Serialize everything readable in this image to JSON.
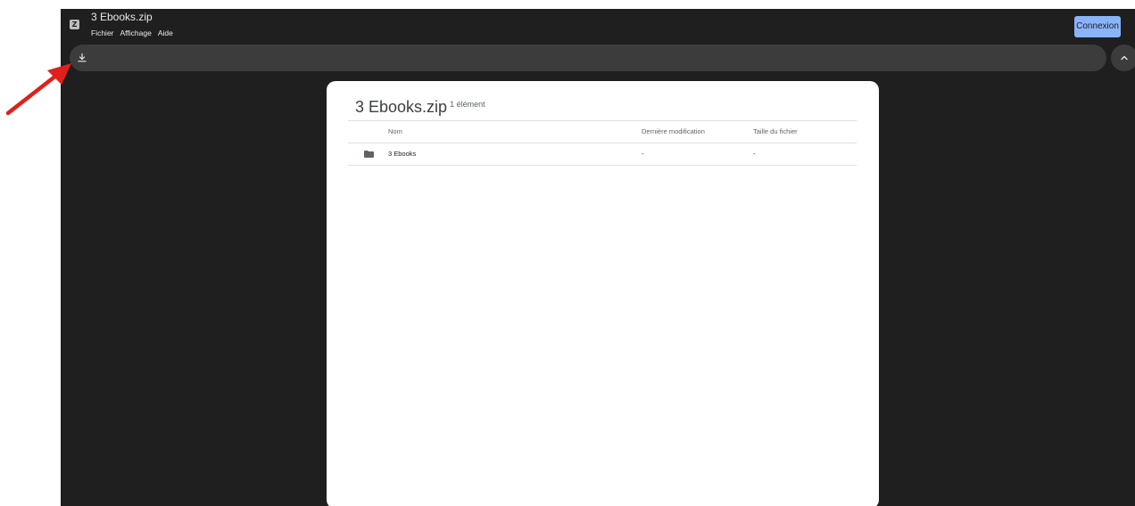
{
  "header": {
    "app_icon_glyph": "Z",
    "title": "3 Ebooks.zip",
    "menu": [
      "Fichier",
      "Affichage",
      "Aide"
    ],
    "connexion_label": "Connexion"
  },
  "toolbar": {
    "download_icon": "download-icon",
    "collapse_icon": "chevron-up-icon"
  },
  "panel": {
    "title": "3 Ebooks.zip",
    "count": "1 élément",
    "columns": {
      "name": "Nom",
      "modified": "Dernière modification",
      "size": "Taille du fichier"
    },
    "rows": [
      {
        "icon": "folder-icon",
        "name": "3 Ebooks",
        "modified": "-",
        "size": "-"
      }
    ]
  },
  "colors": {
    "background": "#1f1f1f",
    "toolbar": "#3c3c3c",
    "accent": "#8ab4f8",
    "annotation_arrow": "#e0201b"
  }
}
